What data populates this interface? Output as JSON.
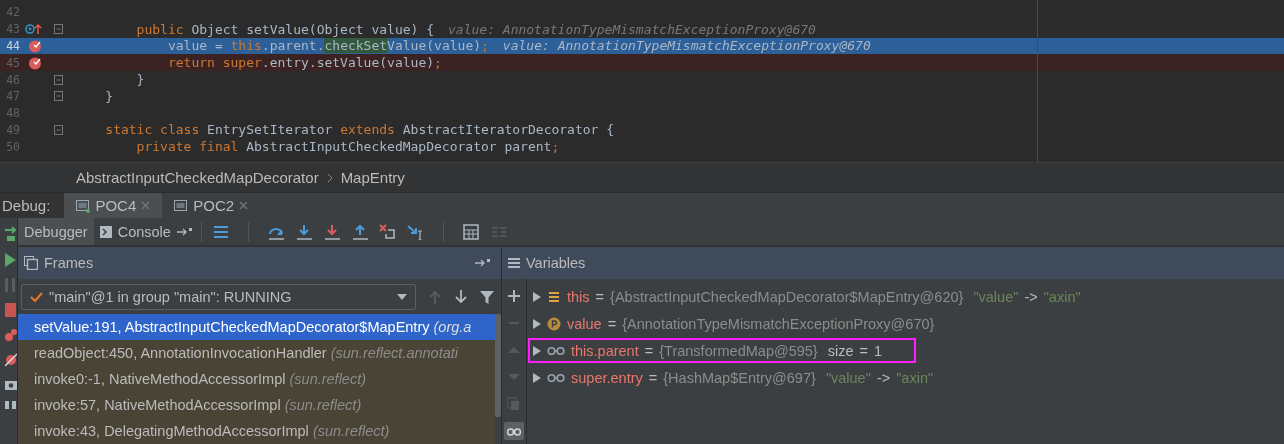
{
  "editor": {
    "lines": [
      {
        "number": "42",
        "override": false,
        "breakpoint": false,
        "execution": false,
        "fold": false
      },
      {
        "number": "43",
        "override": true,
        "breakpoint": false,
        "execution": false,
        "fold": true,
        "code": [
          {
            "text": "        public",
            "kind": "kw"
          },
          {
            "text": " Object setValue(Object value) {",
            "kind": "plain"
          }
        ],
        "hint": "value: AnnotationTypeMismatchExceptionProxy@670"
      },
      {
        "number": "44",
        "override": false,
        "breakpoint": true,
        "execution": true,
        "fold": false,
        "code": [
          {
            "text": "            value = ",
            "kind": "plain"
          },
          {
            "text": "this",
            "kind": "kw"
          },
          {
            "text": ".parent.",
            "kind": "plain"
          },
          {
            "text": "checkSet",
            "kind": "match"
          },
          {
            "text": "Value(value)",
            "kind": "plain"
          },
          {
            "text": ";",
            "kind": "kw"
          }
        ],
        "hint": "value: AnnotationTypeMismatchExceptionProxy@670"
      },
      {
        "number": "45",
        "override": false,
        "breakpoint": true,
        "execution": false,
        "fold": false,
        "code": [
          {
            "text": "            return super",
            "kind": "kw"
          },
          {
            "text": ".entry.setValue(value)",
            "kind": "plain"
          },
          {
            "text": ";",
            "kind": "kw"
          }
        ]
      },
      {
        "number": "46",
        "override": false,
        "breakpoint": false,
        "execution": false,
        "fold": true,
        "code": [
          {
            "text": "        }",
            "kind": "plain"
          }
        ]
      },
      {
        "number": "47",
        "override": false,
        "breakpoint": false,
        "execution": false,
        "fold": true,
        "code": [
          {
            "text": "    }",
            "kind": "plain"
          }
        ]
      },
      {
        "number": "48",
        "override": false,
        "breakpoint": false,
        "execution": false,
        "fold": false
      },
      {
        "number": "49",
        "override": false,
        "breakpoint": false,
        "execution": false,
        "fold": true,
        "code": [
          {
            "text": "    static class ",
            "kind": "kw"
          },
          {
            "text": "EntrySetIterator ",
            "kind": "plain"
          },
          {
            "text": "extends ",
            "kind": "kw"
          },
          {
            "text": "AbstractIteratorDecorator {",
            "kind": "plain"
          }
        ]
      },
      {
        "number": "50",
        "override": false,
        "breakpoint": false,
        "execution": false,
        "fold": false,
        "code": [
          {
            "text": "        private final ",
            "kind": "kw"
          },
          {
            "text": "AbstractInputCheckedMapDecorator parent",
            "kind": "plain"
          },
          {
            "text": ";",
            "kind": "kw"
          }
        ]
      }
    ]
  },
  "breadcrumbs": [
    "AbstractInputCheckedMapDecorator",
    "MapEntry"
  ],
  "debug": {
    "label": "Debug:",
    "tabs": [
      {
        "label": "POC4",
        "selected": true
      },
      {
        "label": "POC2",
        "selected": false
      }
    ],
    "subtabs": [
      {
        "label": "Debugger",
        "selected": true,
        "kind": "debugger"
      },
      {
        "label": "Console",
        "selected": false,
        "kind": "console"
      }
    ]
  },
  "frames": {
    "title": "Frames",
    "thread": "\"main\"@1 in group \"main\": RUNNING",
    "nav": [
      {
        "kind": "up",
        "disabled": true
      },
      {
        "kind": "down",
        "disabled": false
      },
      {
        "kind": "filter",
        "disabled": false
      }
    ],
    "rows": [
      {
        "method": "setValue:191, AbstractInputCheckedMapDecorator$MapEntry",
        "package": "(org.a",
        "selected": true
      },
      {
        "method": "readObject:450, AnnotationInvocationHandler",
        "package": "(sun.reflect.annotati",
        "selected": false
      },
      {
        "method": "invoke0:-1, NativeMethodAccessorImpl",
        "package": "(sun.reflect)",
        "selected": false
      },
      {
        "method": "invoke:57, NativeMethodAccessorImpl",
        "package": "(sun.reflect)",
        "selected": false
      },
      {
        "method": "invoke:43, DelegatingMethodAccessorImpl",
        "package": "(sun.reflect)",
        "selected": false
      }
    ]
  },
  "variables": {
    "title": "Variables",
    "tools": [
      {
        "kind": "add",
        "disabled": false
      },
      {
        "kind": "remove",
        "disabled": true
      },
      {
        "kind": "up",
        "disabled": true
      },
      {
        "kind": "down",
        "disabled": true
      },
      {
        "kind": "copy",
        "disabled": true
      },
      {
        "kind": "watches",
        "disabled": false
      }
    ],
    "rows": [
      {
        "kind": "field",
        "boxed": false,
        "parts": [
          {
            "text": "this",
            "kind": "name"
          },
          {
            "text": "=",
            "kind": "op"
          },
          {
            "text": "{AbstractInputCheckedMapDecorator$MapEntry@620}",
            "kind": "value"
          },
          {
            "text": "\"value\"",
            "kind": "string"
          },
          {
            "text": "->",
            "kind": "op"
          },
          {
            "text": "\"axin\"",
            "kind": "string"
          }
        ]
      },
      {
        "kind": "param",
        "boxed": false,
        "parts": [
          {
            "text": "value",
            "kind": "name"
          },
          {
            "text": "=",
            "kind": "op"
          },
          {
            "text": "{AnnotationTypeMismatchExceptionProxy@670}",
            "kind": "value"
          }
        ]
      },
      {
        "kind": "watch",
        "boxed": true,
        "parts": [
          {
            "text": "this.parent",
            "kind": "name"
          },
          {
            "text": "=",
            "kind": "op"
          },
          {
            "text": "{TransformedMap@595}",
            "kind": "value"
          },
          {
            "text": "size",
            "kind": "plain"
          },
          {
            "text": "=",
            "kind": "op"
          },
          {
            "text": "1",
            "kind": "plain"
          }
        ]
      },
      {
        "kind": "watch",
        "boxed": false,
        "parts": [
          {
            "text": "super.entry",
            "kind": "name"
          },
          {
            "text": "=",
            "kind": "op"
          },
          {
            "text": "{HashMap$Entry@697}",
            "kind": "value"
          },
          {
            "text": "\"value\"",
            "kind": "string"
          },
          {
            "text": "->",
            "kind": "op"
          },
          {
            "text": "\"axin\"",
            "kind": "string"
          }
        ]
      }
    ]
  }
}
